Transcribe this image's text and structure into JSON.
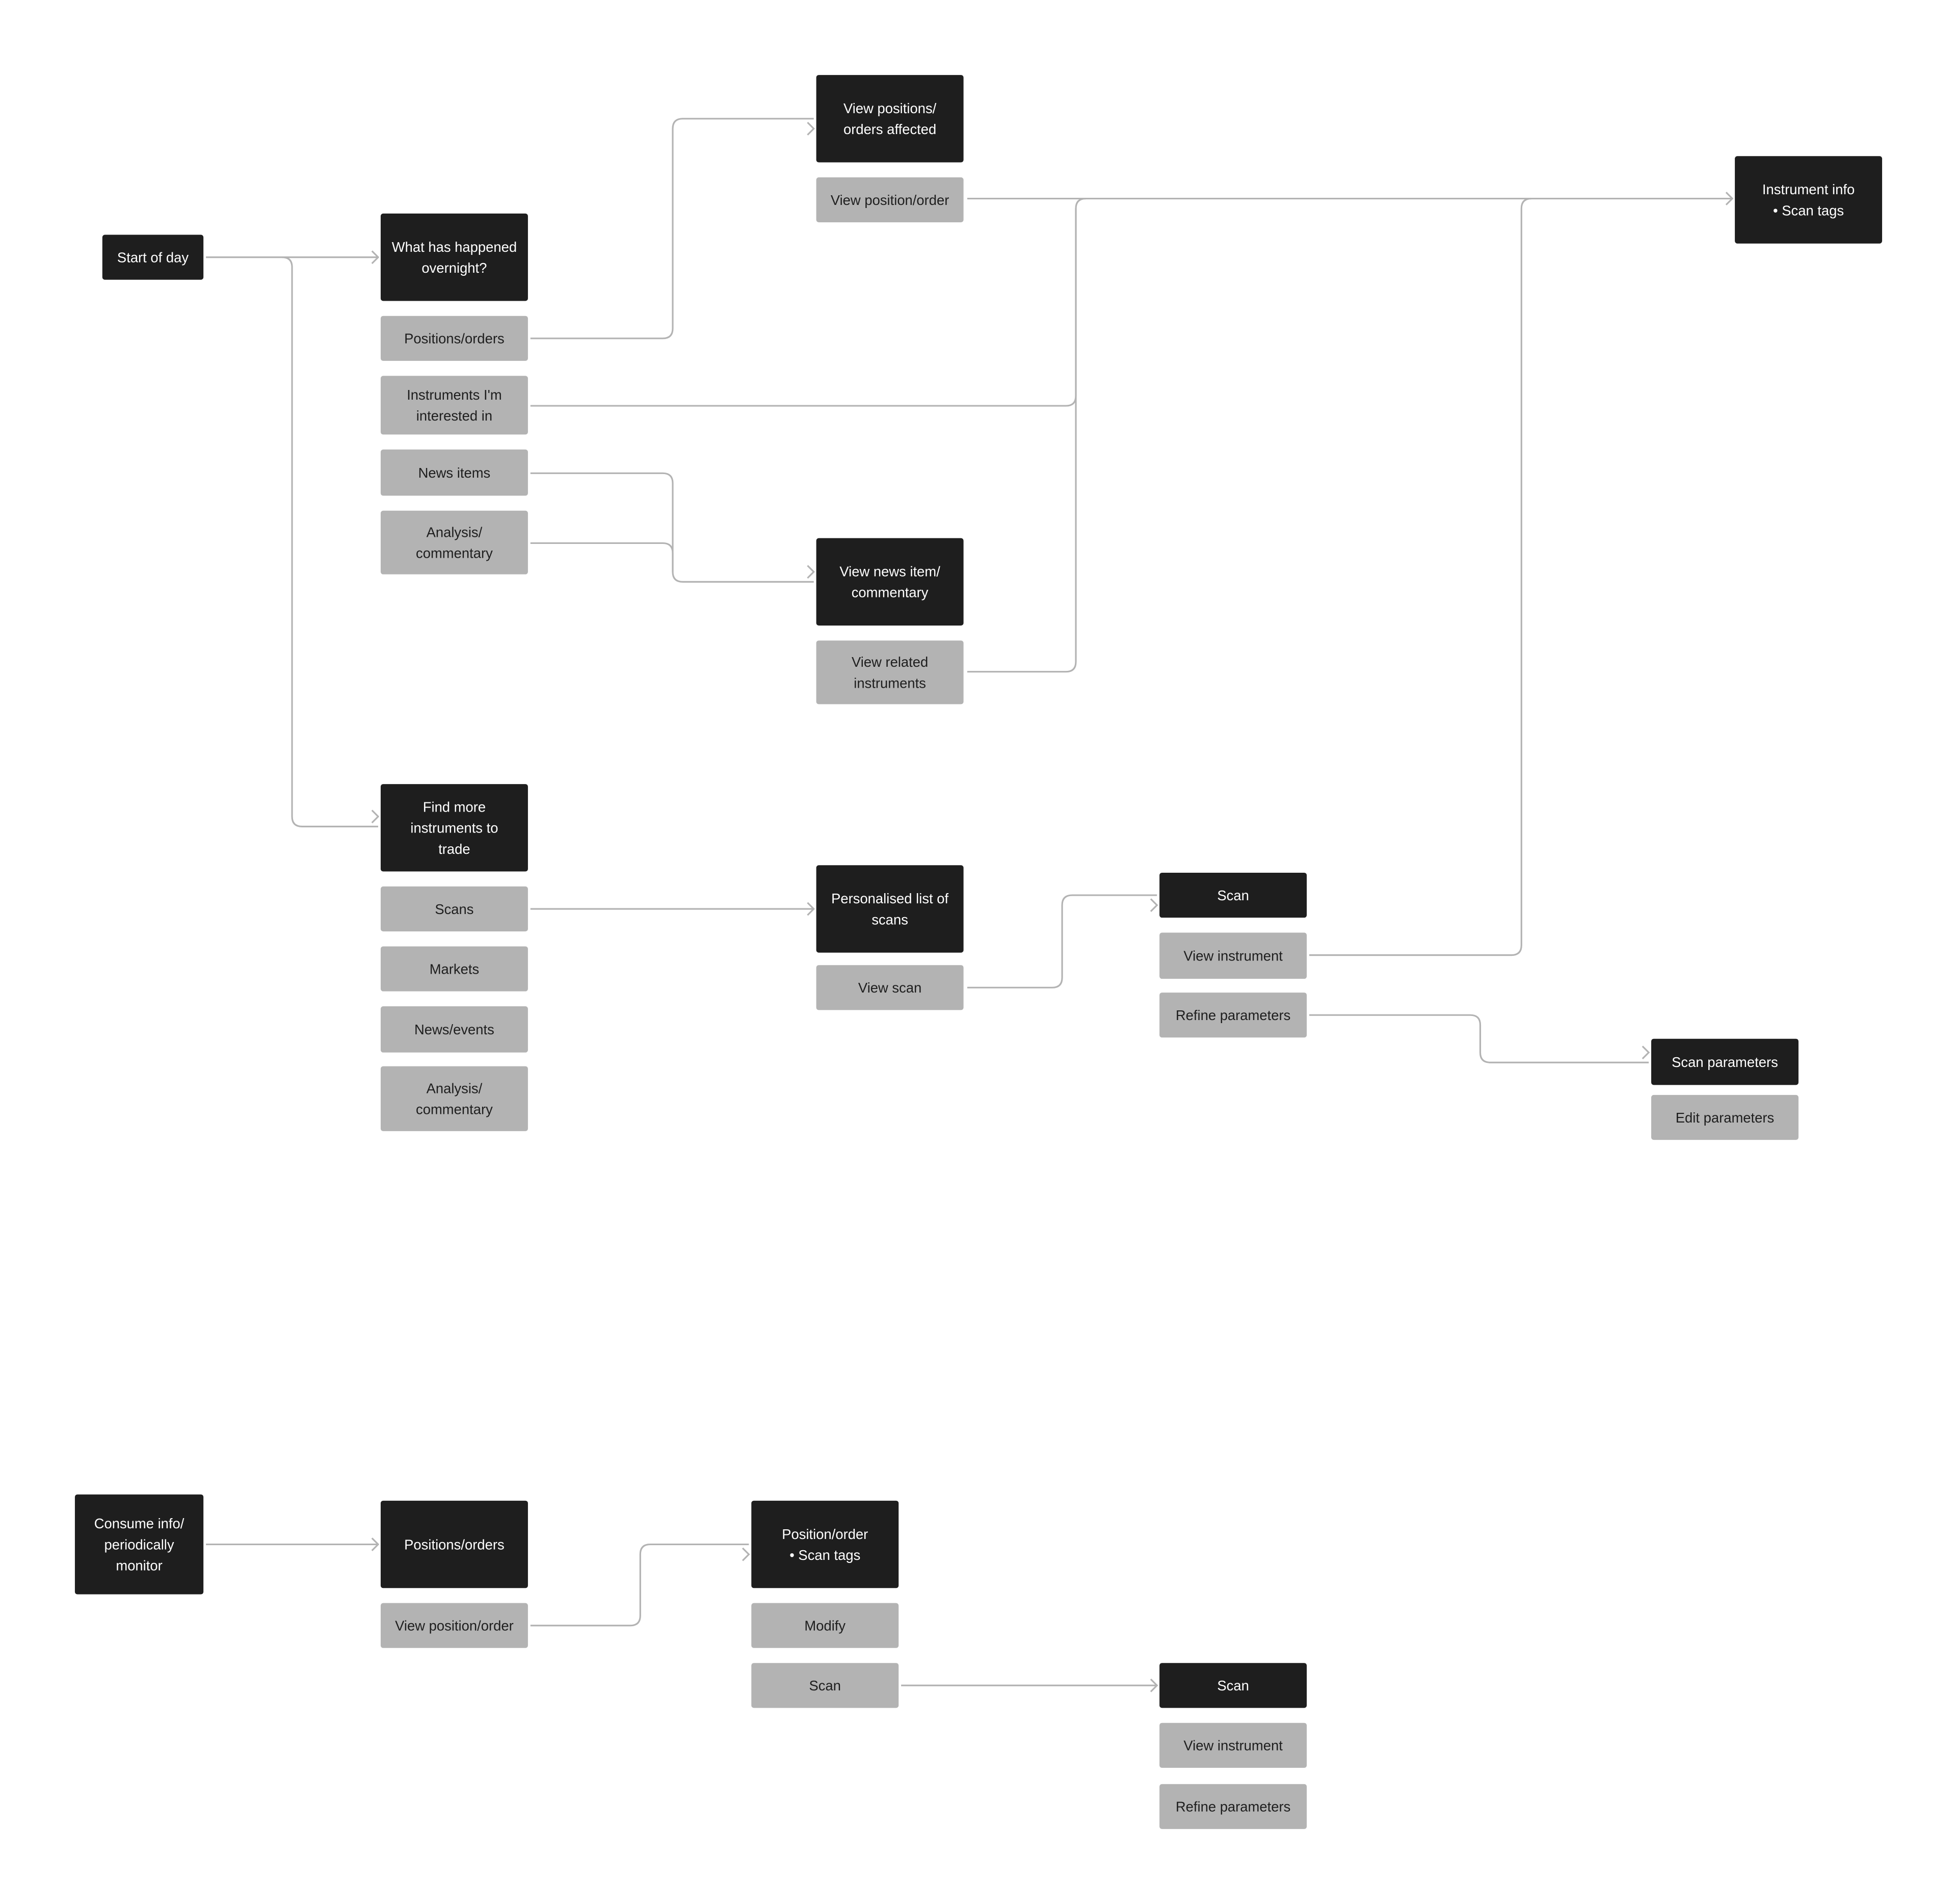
{
  "colors": {
    "primary_node": "#1e1e1e",
    "secondary_node": "#b3b3b3",
    "primary_text": "#ffffff",
    "secondary_text": "#1e1e1e",
    "connector": "#b3b3b3",
    "background": "#ffffff"
  },
  "nodes": {
    "start_of_day": {
      "kind": "primary",
      "lines": [
        "Start of day"
      ]
    },
    "overnight": {
      "kind": "primary",
      "lines": [
        "What has happened",
        "overnight?"
      ]
    },
    "positions_orders": {
      "kind": "secondary",
      "lines": [
        "Positions/orders"
      ]
    },
    "instruments_interested": {
      "kind": "secondary",
      "lines": [
        "Instruments I'm",
        "interested in"
      ]
    },
    "news_items": {
      "kind": "secondary",
      "lines": [
        "News items"
      ]
    },
    "analysis_1": {
      "kind": "secondary",
      "lines": [
        "Analysis/",
        "commentary"
      ]
    },
    "find_more": {
      "kind": "primary",
      "lines": [
        "Find more",
        "instruments to",
        "trade"
      ]
    },
    "scans": {
      "kind": "secondary",
      "lines": [
        "Scans"
      ]
    },
    "markets": {
      "kind": "secondary",
      "lines": [
        "Markets"
      ]
    },
    "news_events": {
      "kind": "secondary",
      "lines": [
        "News/events"
      ]
    },
    "analysis_2": {
      "kind": "secondary",
      "lines": [
        "Analysis/",
        "commentary"
      ]
    },
    "view_positions_affected": {
      "kind": "primary",
      "lines": [
        "View positions/",
        "orders affected"
      ]
    },
    "view_position_order": {
      "kind": "secondary",
      "lines": [
        "View position/order"
      ]
    },
    "view_news_item": {
      "kind": "primary",
      "lines": [
        "View news item/",
        "commentary"
      ]
    },
    "view_related": {
      "kind": "secondary",
      "lines": [
        "View related",
        "instruments"
      ]
    },
    "personalised_scans": {
      "kind": "primary",
      "lines": [
        "Personalised list of",
        "scans"
      ]
    },
    "view_scan": {
      "kind": "secondary",
      "lines": [
        "View scan"
      ]
    },
    "scan_1": {
      "kind": "primary",
      "lines": [
        "Scan"
      ]
    },
    "view_instrument_1": {
      "kind": "secondary",
      "lines": [
        "View instrument"
      ]
    },
    "refine_1": {
      "kind": "secondary",
      "lines": [
        "Refine parameters"
      ]
    },
    "instrument_info": {
      "kind": "primary",
      "lines": [
        "Instrument info",
        "•  Scan tags"
      ]
    },
    "scan_parameters": {
      "kind": "primary",
      "lines": [
        "Scan parameters"
      ]
    },
    "edit_parameters": {
      "kind": "secondary",
      "lines": [
        "Edit parameters"
      ]
    },
    "consume_info": {
      "kind": "primary",
      "lines": [
        "Consume info/",
        "periodically",
        "monitor"
      ]
    },
    "positions_orders_2": {
      "kind": "primary",
      "lines": [
        "Positions/orders"
      ]
    },
    "view_position_order_2": {
      "kind": "secondary",
      "lines": [
        "View position/order"
      ]
    },
    "position_order_tags": {
      "kind": "primary",
      "lines": [
        "Position/order",
        "•  Scan tags"
      ]
    },
    "modify": {
      "kind": "secondary",
      "lines": [
        "Modify"
      ]
    },
    "scan_2": {
      "kind": "secondary",
      "lines": [
        "Scan"
      ]
    },
    "scan_3": {
      "kind": "primary",
      "lines": [
        "Scan"
      ]
    },
    "view_instrument_2": {
      "kind": "secondary",
      "lines": [
        "View instrument"
      ]
    },
    "refine_2": {
      "kind": "secondary",
      "lines": [
        "Refine parameters"
      ]
    }
  },
  "edges": [
    {
      "from": "start_of_day",
      "to": "overnight"
    },
    {
      "from": "start_of_day",
      "to": "find_more"
    },
    {
      "from": "positions_orders",
      "to": "view_positions_affected"
    },
    {
      "from": "view_position_order",
      "to": "instrument_info"
    },
    {
      "from": "instruments_interested",
      "to": "instrument_info"
    },
    {
      "from": "news_items",
      "to": "view_news_item"
    },
    {
      "from": "analysis_1",
      "to": "view_news_item"
    },
    {
      "from": "view_related",
      "to": "instrument_info"
    },
    {
      "from": "scans",
      "to": "personalised_scans"
    },
    {
      "from": "view_scan",
      "to": "scan_1"
    },
    {
      "from": "view_instrument_1",
      "to": "instrument_info"
    },
    {
      "from": "refine_1",
      "to": "scan_parameters"
    },
    {
      "from": "consume_info",
      "to": "positions_orders_2"
    },
    {
      "from": "view_position_order_2",
      "to": "position_order_tags"
    },
    {
      "from": "scan_2",
      "to": "scan_3"
    }
  ]
}
